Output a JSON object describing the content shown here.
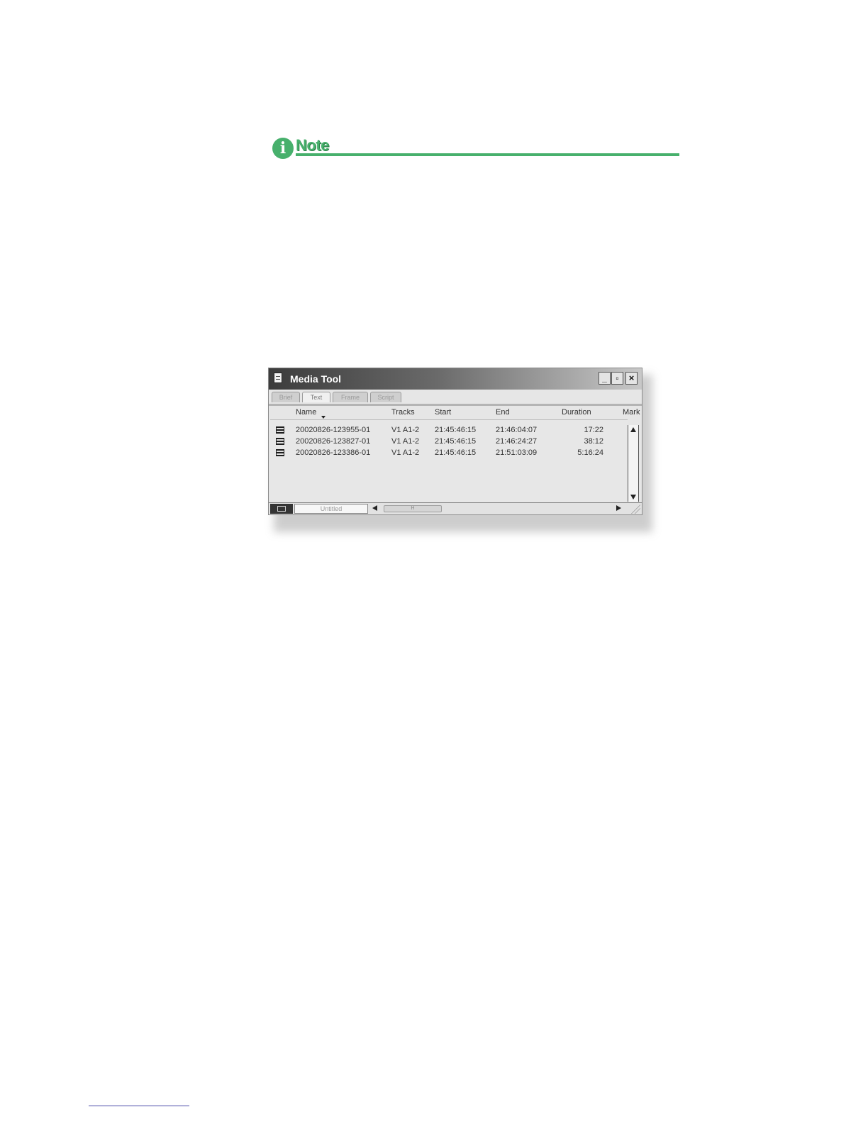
{
  "note": {
    "label": "Note",
    "icon": "info-icon",
    "color": "#47b06c"
  },
  "window": {
    "title": "Media Tool",
    "controls": {
      "minimize": "_",
      "maximize": "▫",
      "close": "×"
    },
    "tabs": [
      {
        "label": "Brief",
        "active": false
      },
      {
        "label": "Text",
        "active": true
      },
      {
        "label": "Frame",
        "active": false
      },
      {
        "label": "Script",
        "active": false
      }
    ],
    "columns": [
      "Name",
      "Tracks",
      "Start",
      "End",
      "Duration",
      "Mark"
    ],
    "rows": [
      {
        "name": "20020826-123955-01",
        "tracks": "V1 A1-2",
        "start": "21:45:46:15",
        "end": "21:46:04:07",
        "duration": "17:22"
      },
      {
        "name": "20020826-123827-01",
        "tracks": "V1 A1-2",
        "start": "21:45:46:15",
        "end": "21:46:24:27",
        "duration": "38:12"
      },
      {
        "name": "20020826-123386-01",
        "tracks": "V1 A1-2",
        "start": "21:45:46:15",
        "end": "21:51:03:09",
        "duration": "5:16:24"
      }
    ],
    "status": {
      "bin_name": "Untitled",
      "slider_label": "H"
    }
  }
}
